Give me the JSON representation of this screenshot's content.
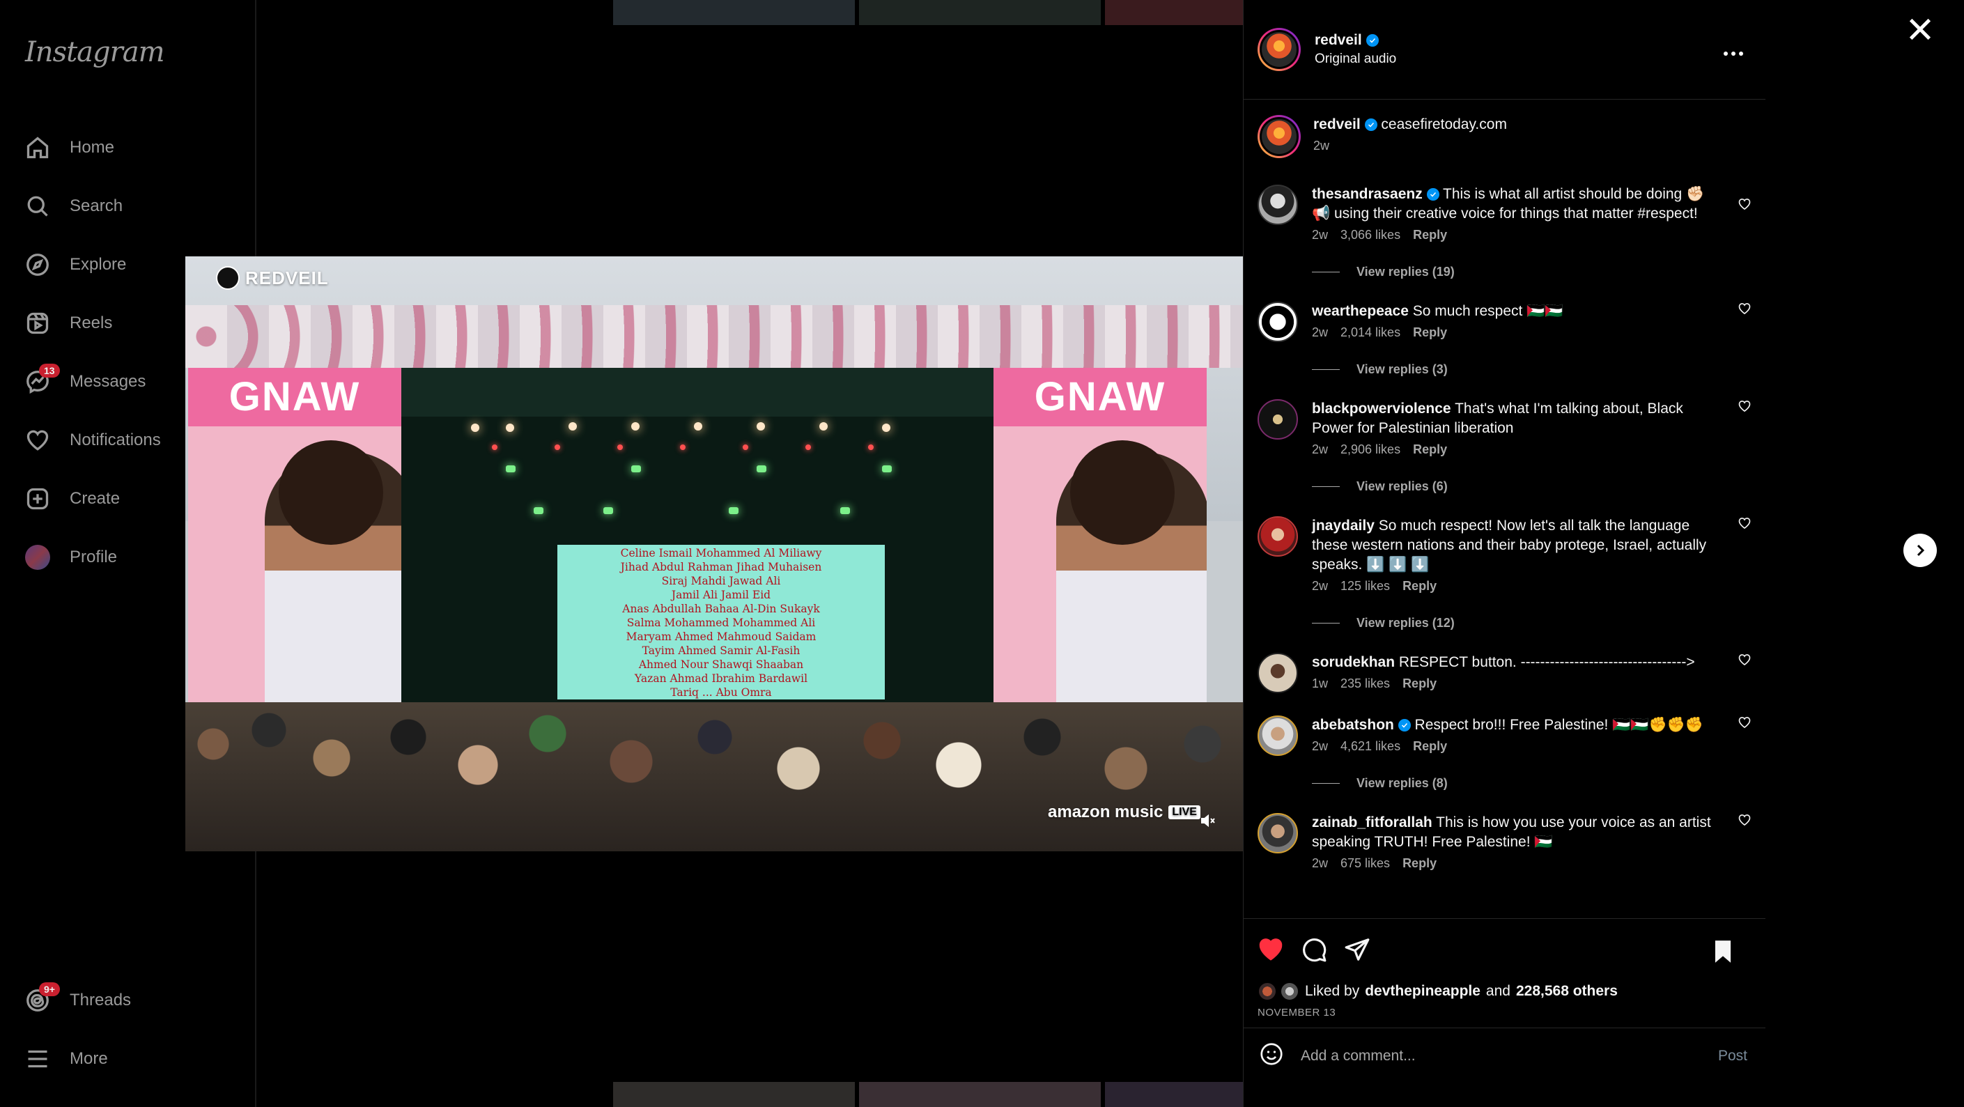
{
  "app": {
    "logo": "Instagram"
  },
  "sidebar": {
    "items": [
      {
        "label": "Home",
        "icon": "home-icon"
      },
      {
        "label": "Search",
        "icon": "search-icon"
      },
      {
        "label": "Explore",
        "icon": "compass-icon"
      },
      {
        "label": "Reels",
        "icon": "reels-icon"
      },
      {
        "label": "Messages",
        "icon": "messenger-icon",
        "badge": "13"
      },
      {
        "label": "Notifications",
        "icon": "heart-icon"
      },
      {
        "label": "Create",
        "icon": "plus-square-icon"
      },
      {
        "label": "Profile",
        "icon": "avatar"
      }
    ],
    "bottom": [
      {
        "label": "Threads",
        "icon": "threads-icon",
        "badge": "9+"
      },
      {
        "label": "More",
        "icon": "hamburger-icon"
      }
    ]
  },
  "media": {
    "watermark": "REDVEIL",
    "stage_banner_left": "GNAW",
    "stage_banner_right": "GNAW",
    "screen_lines": [
      "Celine Ismail Mohammed Al Miliawy",
      "Jihad Abdul Rahman Jihad Muhaisen",
      "Siraj Mahdi Jawad Ali",
      "Jamil Ali Jamil Eid",
      "Anas Abdullah Bahaa Al-Din Sukayk",
      "Salma Mohammed Mohammed Ali",
      "Maryam Ahmed Mahmoud Saidam",
      "Tayim Ahmed Samir Al-Fasih",
      "Ahmed Nour Shawqi Shaaban",
      "Yazan Ahmad Ibrahim Bardawil",
      "Tariq ... Abu Omra"
    ],
    "brand": "amazon music",
    "live_badge": "LIVE"
  },
  "post": {
    "author": "redveil",
    "author_verified": true,
    "audio": "Original audio",
    "caption_user": "redveil",
    "caption_text": "ceasefiretoday.com",
    "caption_time": "2w"
  },
  "comments": [
    {
      "user": "thesandrasaenz",
      "verified": true,
      "text": "This is what all artist should be doing ✊🏻📢 using their creative voice for things that matter #respect!",
      "time": "2w",
      "likes": "3,066 likes",
      "reply": "Reply",
      "view_replies": "View replies (19)"
    },
    {
      "user": "wearthepeace",
      "verified": false,
      "text": "So much respect 🇵🇸🇵🇸",
      "time": "2w",
      "likes": "2,014 likes",
      "reply": "Reply",
      "view_replies": "View replies (3)"
    },
    {
      "user": "blackpowerviolence",
      "verified": false,
      "text": "That's what I'm talking about, Black Power for Palestinian liberation",
      "time": "2w",
      "likes": "2,906 likes",
      "reply": "Reply",
      "view_replies": "View replies (6)"
    },
    {
      "user": "jnaydaily",
      "verified": false,
      "text": "So much respect! Now let's all talk the language these western nations and their baby protege, Israel, actually speaks. ⬇️ ⬇️ ⬇️",
      "time": "2w",
      "likes": "125 likes",
      "reply": "Reply",
      "view_replies": "View replies (12)"
    },
    {
      "user": "sorudekhan",
      "verified": false,
      "text": "RESPECT button. ---------------------------------->",
      "time": "1w",
      "likes": "235 likes",
      "reply": "Reply",
      "view_replies": ""
    },
    {
      "user": "abebatshon",
      "verified": true,
      "text": "Respect bro!!! Free Palestine! 🇵🇸🇵🇸✊✊✊",
      "time": "2w",
      "likes": "4,621 likes",
      "reply": "Reply",
      "view_replies": "View replies (8)"
    },
    {
      "user": "zainab_fitforallah",
      "verified": false,
      "text": "This is how you use your voice as an artist speaking TRUTH! Free Palestine! 🇵🇸",
      "time": "2w",
      "likes": "675 likes",
      "reply": "Reply",
      "view_replies": ""
    }
  ],
  "footer": {
    "liked_prefix": "Liked by",
    "liked_user": "devthepineapple",
    "liked_and": "and",
    "liked_others": "228,568 others",
    "date": "NOVEMBER 13",
    "comment_placeholder": "Add a comment...",
    "post_label": "Post"
  },
  "colors": {
    "like_red": "#ff3040",
    "verified_blue": "#0095f6",
    "badge_red": "#c9202f"
  }
}
